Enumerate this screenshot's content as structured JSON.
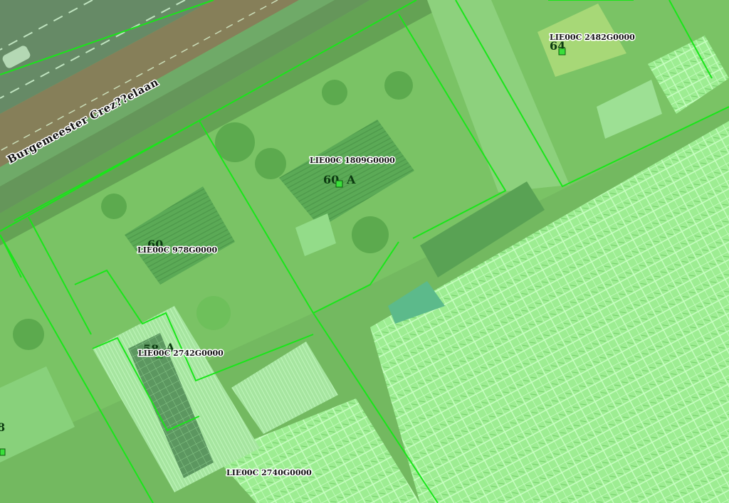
{
  "map": {
    "street_name": "Burgemeester Crez??elaan",
    "parcels": [
      {
        "code": "LIE00C  2482G0000",
        "house_number": "64"
      },
      {
        "code": "LIE00C  1809G0000",
        "house_number": "60",
        "suffix": "A"
      },
      {
        "code": "LIE00C  978G0000",
        "house_number": "60"
      },
      {
        "code": "LIE00C  2742G0000",
        "house_number": "58",
        "suffix": "A"
      },
      {
        "code": "LIE00C  2740G0000"
      }
    ],
    "partial_number_left": "8",
    "colors": {
      "parcel_outline": "#19e619",
      "overlay_tint": "#7dff7d",
      "road": "#5b5b5b",
      "cycle_path": "#8a4a48",
      "label_marker": "#3adf3a"
    }
  }
}
